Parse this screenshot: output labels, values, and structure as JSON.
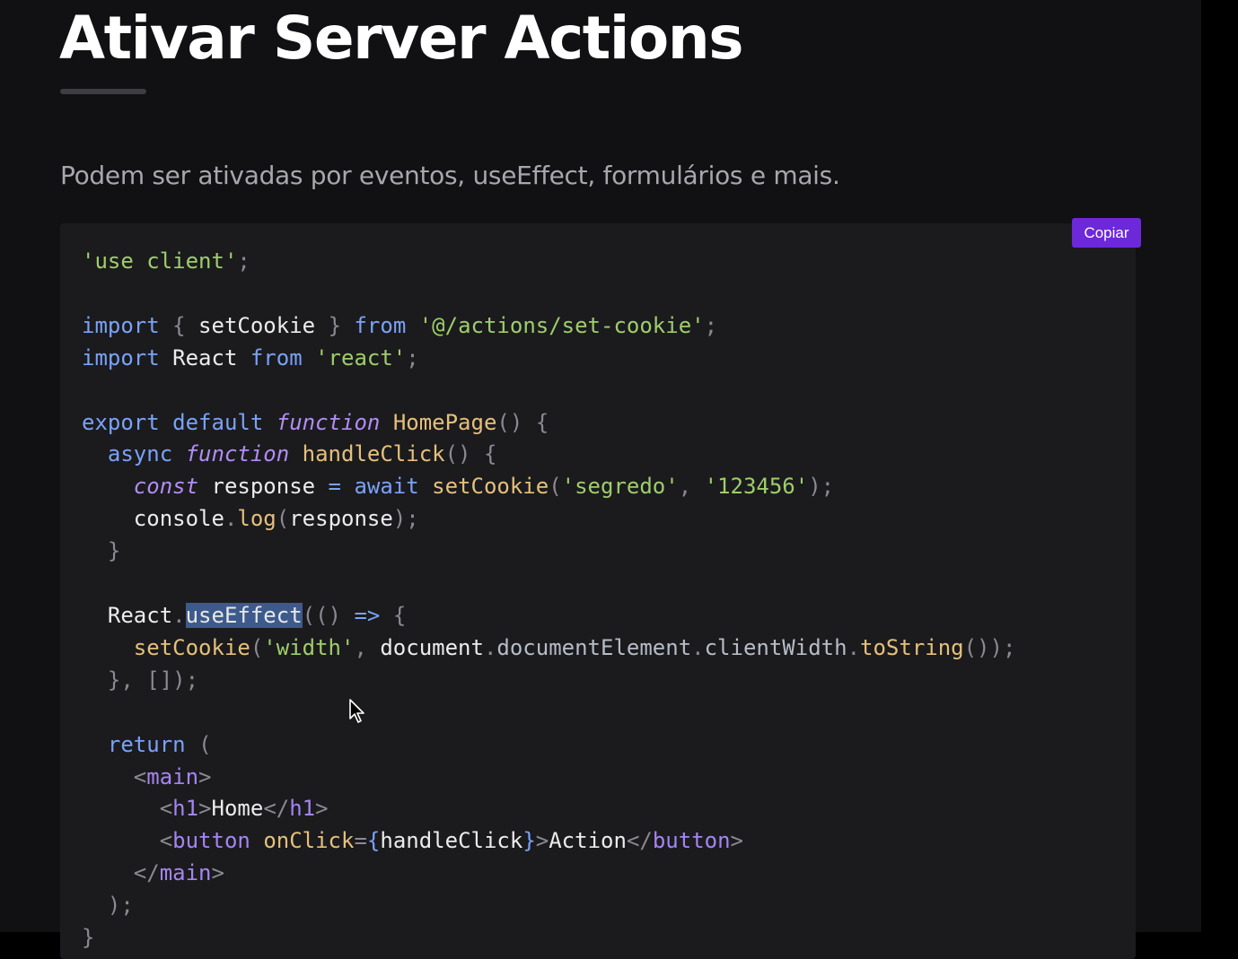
{
  "heading": {
    "title": "Ativar Server Actions",
    "subtitle": "Podem ser ativadas por eventos, useEffect, formulários e mais."
  },
  "code_block": {
    "copy_label": "Copiar",
    "highlight_color": "#3d5a8c",
    "lines": [
      [
        [
          "str",
          "'use client'"
        ],
        [
          "pu",
          ";"
        ]
      ],
      [],
      [
        [
          "kw",
          "import"
        ],
        [
          "id",
          " "
        ],
        [
          "pu",
          "{"
        ],
        [
          "id",
          " setCookie "
        ],
        [
          "pu",
          "}"
        ],
        [
          "id",
          " "
        ],
        [
          "kw",
          "from"
        ],
        [
          "id",
          " "
        ],
        [
          "str",
          "'@/actions/set-cookie'"
        ],
        [
          "pu",
          ";"
        ]
      ],
      [
        [
          "kw",
          "import"
        ],
        [
          "id",
          " React "
        ],
        [
          "kw",
          "from"
        ],
        [
          "id",
          " "
        ],
        [
          "str",
          "'react'"
        ],
        [
          "pu",
          ";"
        ]
      ],
      [],
      [
        [
          "kw",
          "export"
        ],
        [
          "id",
          " "
        ],
        [
          "kw",
          "default"
        ],
        [
          "id",
          " "
        ],
        [
          "it",
          "function"
        ],
        [
          "id",
          " "
        ],
        [
          "fn",
          "HomePage"
        ],
        [
          "pu",
          "() {"
        ]
      ],
      [
        [
          "id",
          "  "
        ],
        [
          "kw",
          "async"
        ],
        [
          "id",
          " "
        ],
        [
          "it",
          "function"
        ],
        [
          "id",
          " "
        ],
        [
          "fn",
          "handleClick"
        ],
        [
          "pu",
          "() {"
        ]
      ],
      [
        [
          "id",
          "    "
        ],
        [
          "it",
          "const"
        ],
        [
          "id",
          " response "
        ],
        [
          "kw",
          "="
        ],
        [
          "id",
          " "
        ],
        [
          "kw",
          "await"
        ],
        [
          "id",
          " "
        ],
        [
          "fn",
          "setCookie"
        ],
        [
          "pu",
          "("
        ],
        [
          "str",
          "'segredo'"
        ],
        [
          "pu",
          ", "
        ],
        [
          "str",
          "'123456'"
        ],
        [
          "pu",
          ");"
        ]
      ],
      [
        [
          "id",
          "    console"
        ],
        [
          "pu",
          "."
        ],
        [
          "fn",
          "log"
        ],
        [
          "pu",
          "("
        ],
        [
          "id",
          "response"
        ],
        [
          "pu",
          ");"
        ]
      ],
      [
        [
          "id",
          "  "
        ],
        [
          "pu",
          "}"
        ]
      ],
      [],
      [
        [
          "id",
          "  React"
        ],
        [
          "pu",
          "."
        ],
        [
          "hl",
          "useEffect"
        ],
        [
          "pu",
          "(() "
        ],
        [
          "kw",
          "=>"
        ],
        [
          "id",
          " "
        ],
        [
          "pu",
          "{"
        ]
      ],
      [
        [
          "id",
          "    "
        ],
        [
          "fn",
          "setCookie"
        ],
        [
          "pu",
          "("
        ],
        [
          "str",
          "'width'"
        ],
        [
          "pu",
          ", "
        ],
        [
          "id",
          "document"
        ],
        [
          "pu",
          "."
        ],
        [
          "prop",
          "documentElement"
        ],
        [
          "pu",
          "."
        ],
        [
          "prop",
          "clientWidth"
        ],
        [
          "pu",
          "."
        ],
        [
          "fn",
          "toString"
        ],
        [
          "pu",
          "());"
        ]
      ],
      [
        [
          "id",
          "  "
        ],
        [
          "pu",
          "}, []);"
        ]
      ],
      [],
      [
        [
          "id",
          "  "
        ],
        [
          "kw",
          "return"
        ],
        [
          "id",
          " "
        ],
        [
          "pu",
          "("
        ]
      ],
      [
        [
          "id",
          "    "
        ],
        [
          "pu",
          "<"
        ],
        [
          "tag",
          "main"
        ],
        [
          "pu",
          ">"
        ]
      ],
      [
        [
          "id",
          "      "
        ],
        [
          "pu",
          "<"
        ],
        [
          "tag",
          "h1"
        ],
        [
          "pu",
          ">"
        ],
        [
          "id",
          "Home"
        ],
        [
          "pu",
          "</"
        ],
        [
          "tag",
          "h1"
        ],
        [
          "pu",
          ">"
        ]
      ],
      [
        [
          "id",
          "      "
        ],
        [
          "pu",
          "<"
        ],
        [
          "tag",
          "button"
        ],
        [
          "id",
          " "
        ],
        [
          "fn",
          "onClick"
        ],
        [
          "pu",
          "="
        ],
        [
          "kw",
          "{"
        ],
        [
          "id",
          "handleClick"
        ],
        [
          "kw",
          "}"
        ],
        [
          "pu",
          ">"
        ],
        [
          "id",
          "Action"
        ],
        [
          "pu",
          "</"
        ],
        [
          "tag",
          "button"
        ],
        [
          "pu",
          ">"
        ]
      ],
      [
        [
          "id",
          "    "
        ],
        [
          "pu",
          "</"
        ],
        [
          "tag",
          "main"
        ],
        [
          "pu",
          ">"
        ]
      ],
      [
        [
          "id",
          "  "
        ],
        [
          "pu",
          ");"
        ]
      ],
      [
        [
          "pu",
          "}"
        ]
      ]
    ]
  }
}
